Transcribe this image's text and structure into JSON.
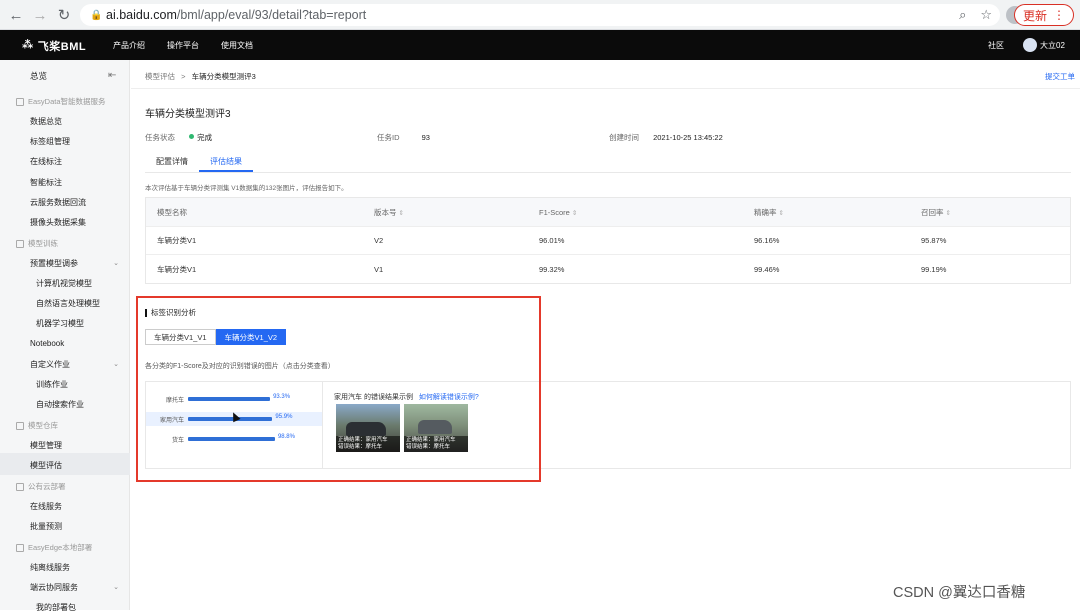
{
  "browser": {
    "url_host": "ai.baidu.com",
    "url_path": "/bml/app/eval/93/detail?tab=report",
    "update_label": "更新"
  },
  "topnav": {
    "brand": "飞桨BML",
    "menu": [
      "产品介绍",
      "操作平台",
      "使用文档"
    ],
    "community": "社区",
    "user": "大立02"
  },
  "sidebar": {
    "overview": "总览",
    "groups": {
      "easydata": "EasyData智能数据服务",
      "training": "模型训练",
      "warehouse": "模型仓库",
      "cloud": "公有云部署",
      "edge": "EasyEdge本地部署"
    },
    "items": {
      "data_overview": "数据总览",
      "label_group": "标签组管理",
      "online_label": "在线标注",
      "smart_label": "智能标注",
      "cloud_backflow": "云服务数据回流",
      "camera": "摄像头数据采集",
      "preset_tune": "预置模型调参",
      "cv_model": "计算机视觉模型",
      "nlp_model": "自然语言处理模型",
      "ml_model": "机器学习模型",
      "notebook": "Notebook",
      "custom_job": "自定义作业",
      "train_job": "训练作业",
      "auto_search": "自动搜索作业",
      "model_manage": "模型管理",
      "model_eval": "模型评估",
      "online_service": "在线服务",
      "batch_predict": "批量预测",
      "pure_offline": "纯离线服务",
      "edge_cloud": "端云协同服务",
      "my_packages": "我的部署包"
    }
  },
  "main": {
    "breadcrumb_parent": "模型评估",
    "breadcrumb_sep": ">",
    "breadcrumb_current": "车辆分类模型测评3",
    "ticket": "提交工单",
    "title": "车辆分类模型测评3",
    "meta": {
      "status_label": "任务状态",
      "status_value": "完成",
      "id_label": "任务ID",
      "id_value": "93",
      "time_label": "创建时间",
      "time_value": "2021-10-25 13:45:22"
    },
    "tabs": [
      "配置详情",
      "评估结果"
    ],
    "description": "本次评估基于车辆分类评测集 V1数据集的132张图片，评估报告如下。",
    "table": {
      "headers": [
        "模型名称",
        "版本号",
        "F1-Score",
        "精确率",
        "召回率"
      ],
      "rows": [
        [
          "车辆分类V1",
          "V2",
          "96.01%",
          "96.16%",
          "95.87%"
        ],
        [
          "车辆分类V1",
          "V1",
          "99.32%",
          "99.46%",
          "99.19%"
        ]
      ]
    },
    "analysis": {
      "title": "标签识别分析",
      "versions": [
        "车辆分类V1_V1",
        "车辆分类V1_V2"
      ],
      "hint": "各分类的F1-Score及对应的识别错误的图片（点击分类查看）",
      "bars": [
        {
          "label": "摩托车",
          "value": 93.3,
          "value_text": "93.3%"
        },
        {
          "label": "家用汽车",
          "value": 95.9,
          "value_text": "95.9%"
        },
        {
          "label": "货车",
          "value": 98.8,
          "value_text": "98.8%"
        }
      ],
      "error_title": "家用汽车 的错误结果示例",
      "error_link": "如何解读错误示例?",
      "thumbs": [
        {
          "line1": "正确结果：家用汽车",
          "line2": "错误结果：摩托车"
        },
        {
          "line1": "正确结果：家用汽车",
          "line2": "错误结果：摩托车"
        }
      ]
    }
  },
  "watermark": "CSDN @翼达口香糖"
}
